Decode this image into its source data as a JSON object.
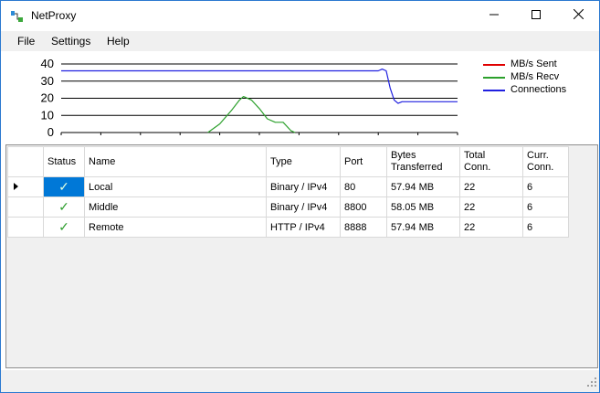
{
  "window": {
    "title": "NetProxy"
  },
  "menu": {
    "items": [
      "File",
      "Settings",
      "Help"
    ]
  },
  "chart_data": {
    "type": "line",
    "yticks": [
      "40",
      "30",
      "20",
      "10",
      "0"
    ],
    "ylim": [
      0,
      40
    ],
    "x_points": 100,
    "series": [
      {
        "name": "MB/s Sent",
        "color": "#e00000",
        "values": []
      },
      {
        "name": "MB/s Recv",
        "color": "#2ca02c",
        "points": [
          [
            37,
            0
          ],
          [
            40,
            5
          ],
          [
            43,
            13
          ],
          [
            45,
            19
          ],
          [
            46,
            21
          ],
          [
            48,
            19
          ],
          [
            50,
            14
          ],
          [
            52,
            8
          ],
          [
            54,
            6
          ],
          [
            56,
            6
          ],
          [
            58,
            1
          ],
          [
            59,
            0
          ]
        ]
      },
      {
        "name": "Connections",
        "color": "#2020e0",
        "points": [
          [
            0,
            36
          ],
          [
            80,
            36
          ],
          [
            81,
            37
          ],
          [
            82,
            36
          ],
          [
            83,
            26
          ],
          [
            84,
            19
          ],
          [
            85,
            17
          ],
          [
            86,
            18
          ],
          [
            88,
            18
          ],
          [
            90,
            18
          ],
          [
            100,
            18
          ]
        ]
      }
    ],
    "legend": "right"
  },
  "table": {
    "headers": [
      "Status",
      "Name",
      "Type",
      "Port",
      "Bytes\nTransferred",
      "Total\nConn.",
      "Curr.\nConn."
    ],
    "rows": [
      {
        "current": true,
        "status": "✓",
        "name": "Local",
        "type": "Binary / IPv4",
        "port": "80",
        "bytes": "57.94 MB",
        "total": "22",
        "curr": "6"
      },
      {
        "current": false,
        "status": "✓",
        "name": "Middle",
        "type": "Binary / IPv4",
        "port": "8800",
        "bytes": "58.05 MB",
        "total": "22",
        "curr": "6"
      },
      {
        "current": false,
        "status": "✓",
        "name": "Remote",
        "type": "HTTP / IPv4",
        "port": "8888",
        "bytes": "57.94 MB",
        "total": "22",
        "curr": "6"
      }
    ]
  }
}
